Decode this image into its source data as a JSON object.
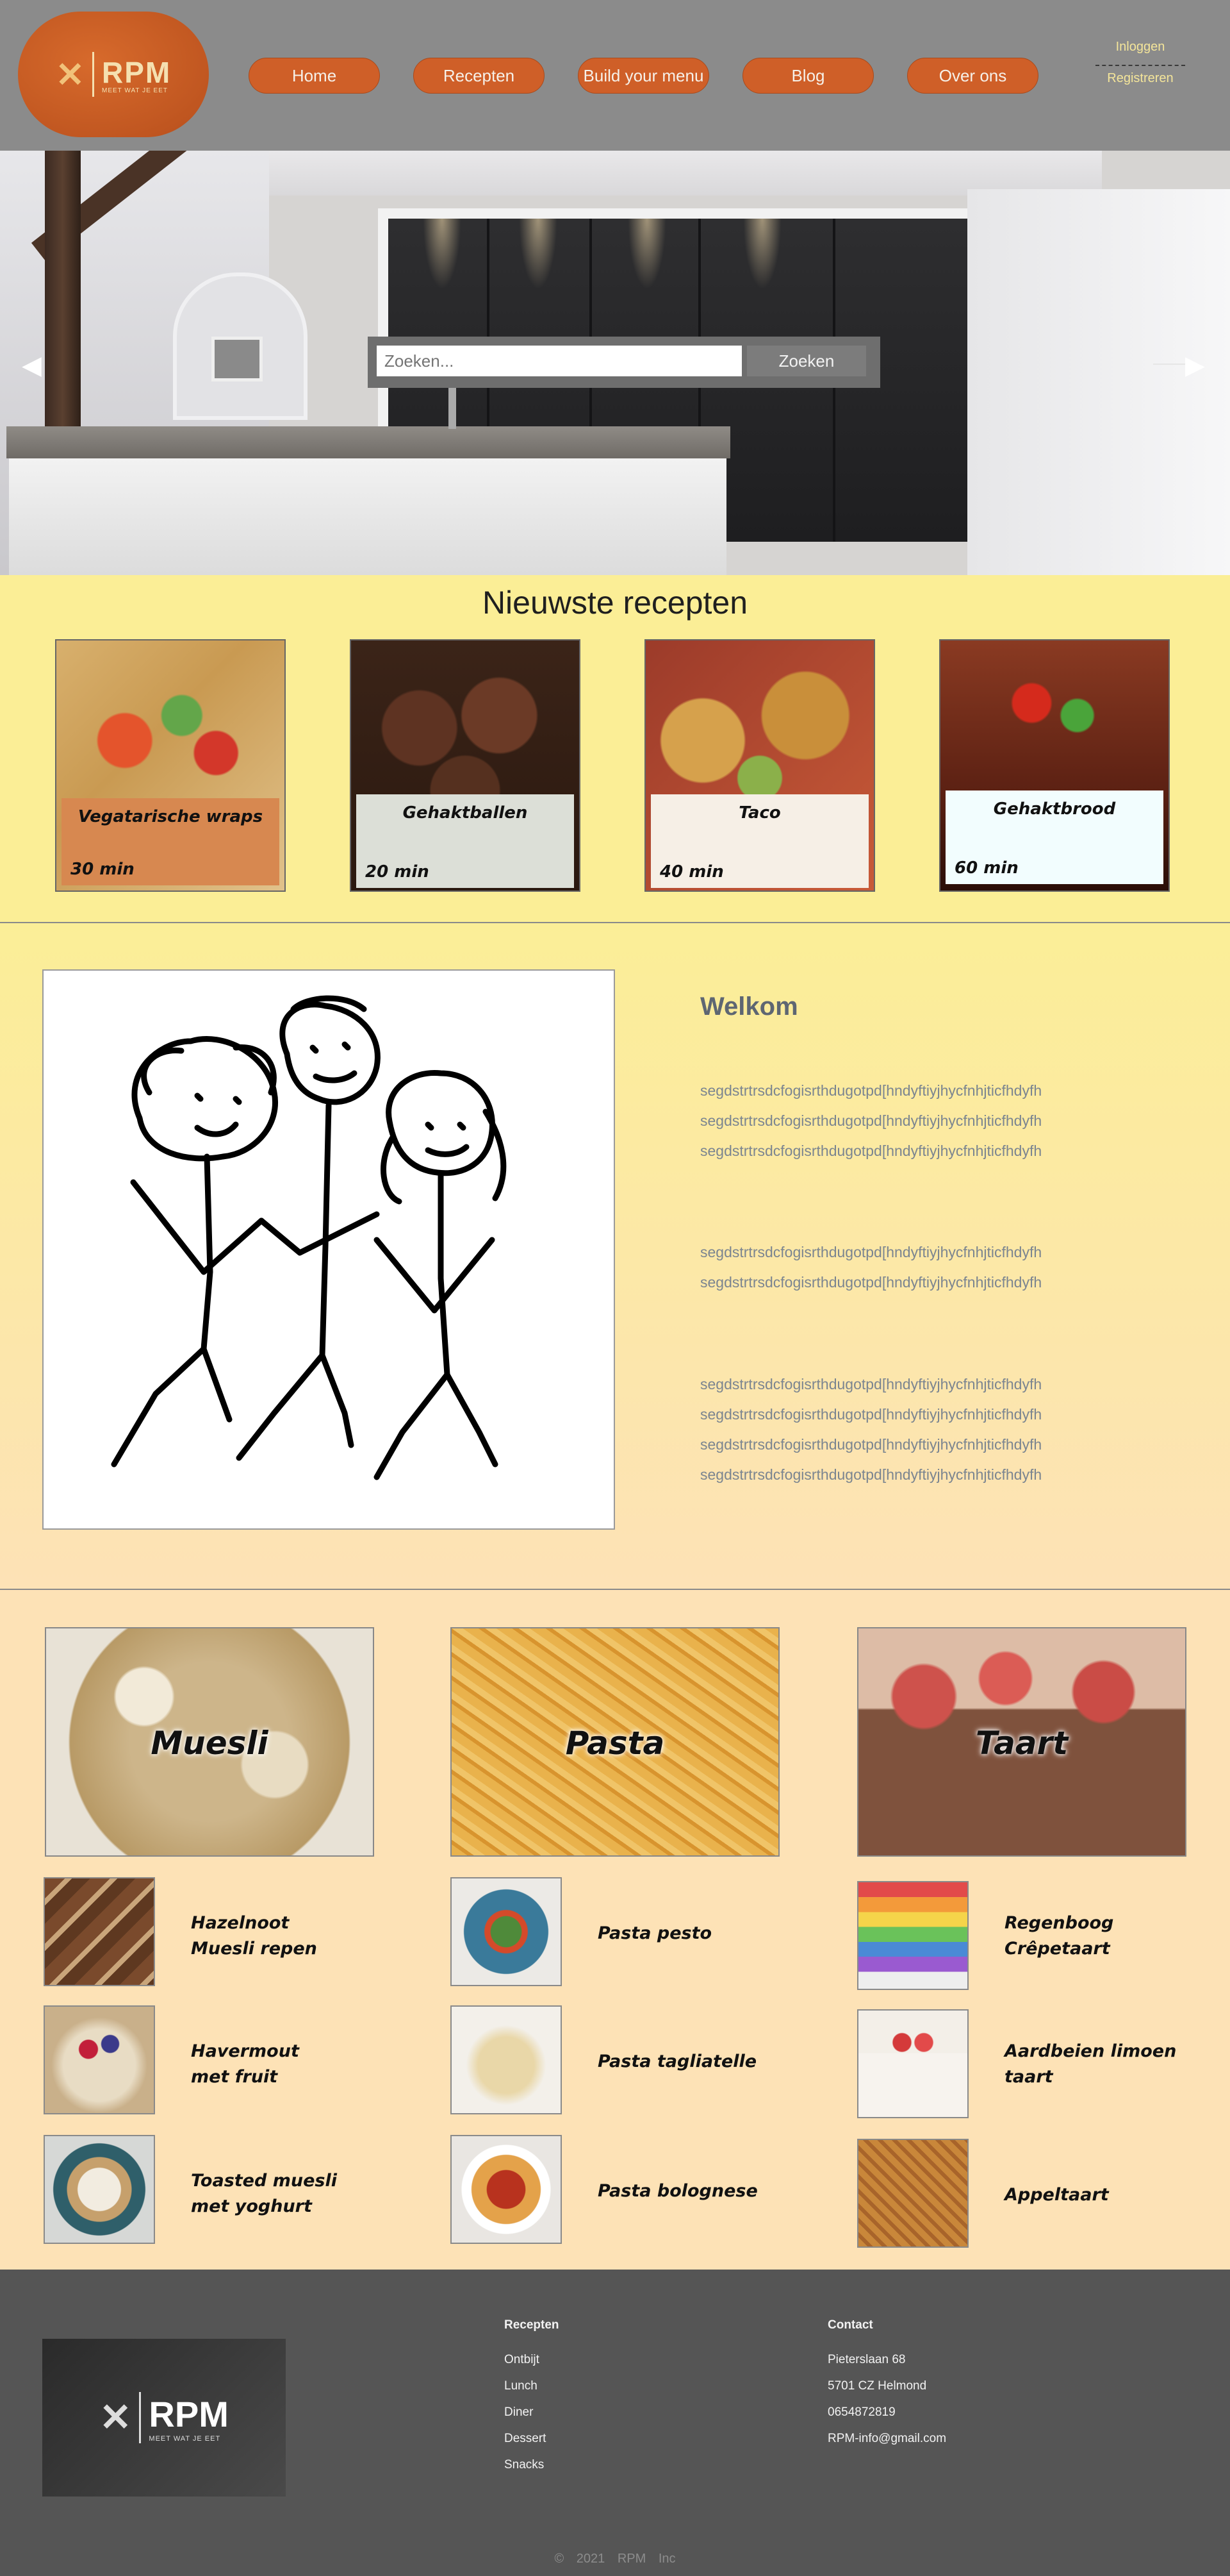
{
  "brand": {
    "logo_text": "RPM",
    "logo_tagline": "MEET WAT JE EET"
  },
  "nav": {
    "items": [
      "Home",
      "Recepten",
      "Build your menu",
      "Blog",
      "Over ons"
    ],
    "login": "Inloggen",
    "register": "Registreren"
  },
  "hero": {
    "search_placeholder": "Zoeken...",
    "search_button": "Zoeken",
    "prev_arrow": "◀",
    "next_arrow": "▶"
  },
  "newest": {
    "title": "Nieuwste recepten",
    "cards": [
      {
        "title": "Vegatarische wraps",
        "time": "30 min"
      },
      {
        "title": "Gehaktballen",
        "time": "20 min"
      },
      {
        "title": "Taco",
        "time": "40 min"
      },
      {
        "title": "Gehaktbrood",
        "time": "60 min"
      }
    ]
  },
  "welcome": {
    "title": "Welkom",
    "paragraphs": [
      "segdstrtrsdcfogisrthdugotpd[hndyftiyjhycfnhjticfhdyfh segdstrtrsdcfogisrthdugotpd[hndyftiyjhycfnhjticfhdyfh segdstrtrsdcfogisrthdugotpd[hndyftiyjhycfnhjticfhdyfh",
      "segdstrtrsdcfogisrthdugotpd[hndyftiyjhycfnhjticfhdyfh segdstrtrsdcfogisrthdugotpd[hndyftiyjhycfnhjticfhdyfh",
      "segdstrtrsdcfogisrthdugotpd[hndyftiyjhycfnhjticfhdyfh segdstrtrsdcfogisrthdugotpd[hndyftiyjhycfnhjticfhdyfh segdstrtrsdcfogisrthdugotpd[hndyftiyjhycfnhjticfhdyfh segdstrtrsdcfogisrthdugotpd[hndyftiyjhycfnhjticfhdyfh"
    ]
  },
  "categories": [
    {
      "title": "Muesli",
      "items": [
        "Hazelnoot\nMuesli repen",
        "Havermout\nmet fruit",
        "Toasted muesli\nmet yoghurt"
      ]
    },
    {
      "title": "Pasta",
      "items": [
        "Pasta pesto",
        "Pasta tagliatelle",
        "Pasta bolognese"
      ]
    },
    {
      "title": "Taart",
      "items": [
        "Regenboog\nCrêpetaart",
        "Aardbeien limoen\ntaart",
        "Appeltaart"
      ]
    }
  ],
  "footer": {
    "recipes_heading": "Recepten",
    "recipes": [
      "Ontbijt",
      "Lunch",
      "Diner",
      "Dessert",
      "Snacks"
    ],
    "contact_heading": "Contact",
    "contact": [
      "Pieterslaan 68",
      "5701 CZ Helmond",
      "0654872819",
      "RPM-info@gmail.com"
    ],
    "copyright": "©   2021   RPM Inc"
  },
  "colors": {
    "accent": "#cf5f28",
    "header_bg": "#8b8b8b",
    "newest_bg": "#fbee96",
    "category_bg": "#fde2b6",
    "footer_bg": "#555555"
  }
}
